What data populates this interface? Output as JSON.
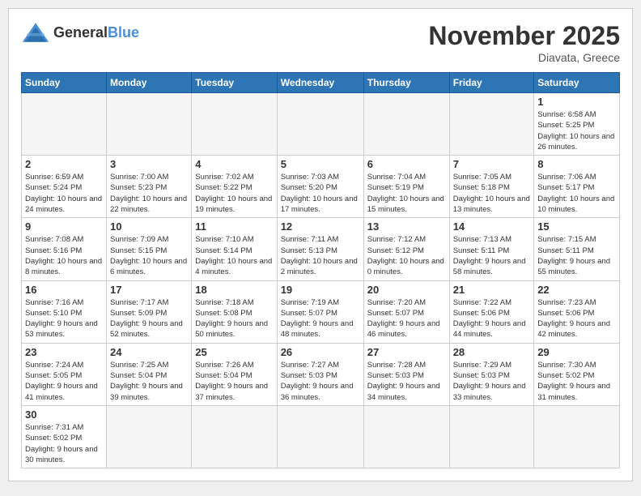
{
  "header": {
    "logo_general": "General",
    "logo_blue": "Blue",
    "month_title": "November 2025",
    "location": "Diavata, Greece"
  },
  "weekdays": [
    "Sunday",
    "Monday",
    "Tuesday",
    "Wednesday",
    "Thursday",
    "Friday",
    "Saturday"
  ],
  "weeks": [
    [
      {
        "day": "",
        "info": ""
      },
      {
        "day": "",
        "info": ""
      },
      {
        "day": "",
        "info": ""
      },
      {
        "day": "",
        "info": ""
      },
      {
        "day": "",
        "info": ""
      },
      {
        "day": "",
        "info": ""
      },
      {
        "day": "1",
        "info": "Sunrise: 6:58 AM\nSunset: 5:25 PM\nDaylight: 10 hours\nand 26 minutes."
      }
    ],
    [
      {
        "day": "2",
        "info": "Sunrise: 6:59 AM\nSunset: 5:24 PM\nDaylight: 10 hours\nand 24 minutes."
      },
      {
        "day": "3",
        "info": "Sunrise: 7:00 AM\nSunset: 5:23 PM\nDaylight: 10 hours\nand 22 minutes."
      },
      {
        "day": "4",
        "info": "Sunrise: 7:02 AM\nSunset: 5:22 PM\nDaylight: 10 hours\nand 19 minutes."
      },
      {
        "day": "5",
        "info": "Sunrise: 7:03 AM\nSunset: 5:20 PM\nDaylight: 10 hours\nand 17 minutes."
      },
      {
        "day": "6",
        "info": "Sunrise: 7:04 AM\nSunset: 5:19 PM\nDaylight: 10 hours\nand 15 minutes."
      },
      {
        "day": "7",
        "info": "Sunrise: 7:05 AM\nSunset: 5:18 PM\nDaylight: 10 hours\nand 13 minutes."
      },
      {
        "day": "8",
        "info": "Sunrise: 7:06 AM\nSunset: 5:17 PM\nDaylight: 10 hours\nand 10 minutes."
      }
    ],
    [
      {
        "day": "9",
        "info": "Sunrise: 7:08 AM\nSunset: 5:16 PM\nDaylight: 10 hours\nand 8 minutes."
      },
      {
        "day": "10",
        "info": "Sunrise: 7:09 AM\nSunset: 5:15 PM\nDaylight: 10 hours\nand 6 minutes."
      },
      {
        "day": "11",
        "info": "Sunrise: 7:10 AM\nSunset: 5:14 PM\nDaylight: 10 hours\nand 4 minutes."
      },
      {
        "day": "12",
        "info": "Sunrise: 7:11 AM\nSunset: 5:13 PM\nDaylight: 10 hours\nand 2 minutes."
      },
      {
        "day": "13",
        "info": "Sunrise: 7:12 AM\nSunset: 5:12 PM\nDaylight: 10 hours\nand 0 minutes."
      },
      {
        "day": "14",
        "info": "Sunrise: 7:13 AM\nSunset: 5:11 PM\nDaylight: 9 hours\nand 58 minutes."
      },
      {
        "day": "15",
        "info": "Sunrise: 7:15 AM\nSunset: 5:11 PM\nDaylight: 9 hours\nand 55 minutes."
      }
    ],
    [
      {
        "day": "16",
        "info": "Sunrise: 7:16 AM\nSunset: 5:10 PM\nDaylight: 9 hours\nand 53 minutes."
      },
      {
        "day": "17",
        "info": "Sunrise: 7:17 AM\nSunset: 5:09 PM\nDaylight: 9 hours\nand 52 minutes."
      },
      {
        "day": "18",
        "info": "Sunrise: 7:18 AM\nSunset: 5:08 PM\nDaylight: 9 hours\nand 50 minutes."
      },
      {
        "day": "19",
        "info": "Sunrise: 7:19 AM\nSunset: 5:07 PM\nDaylight: 9 hours\nand 48 minutes."
      },
      {
        "day": "20",
        "info": "Sunrise: 7:20 AM\nSunset: 5:07 PM\nDaylight: 9 hours\nand 46 minutes."
      },
      {
        "day": "21",
        "info": "Sunrise: 7:22 AM\nSunset: 5:06 PM\nDaylight: 9 hours\nand 44 minutes."
      },
      {
        "day": "22",
        "info": "Sunrise: 7:23 AM\nSunset: 5:06 PM\nDaylight: 9 hours\nand 42 minutes."
      }
    ],
    [
      {
        "day": "23",
        "info": "Sunrise: 7:24 AM\nSunset: 5:05 PM\nDaylight: 9 hours\nand 41 minutes."
      },
      {
        "day": "24",
        "info": "Sunrise: 7:25 AM\nSunset: 5:04 PM\nDaylight: 9 hours\nand 39 minutes."
      },
      {
        "day": "25",
        "info": "Sunrise: 7:26 AM\nSunset: 5:04 PM\nDaylight: 9 hours\nand 37 minutes."
      },
      {
        "day": "26",
        "info": "Sunrise: 7:27 AM\nSunset: 5:03 PM\nDaylight: 9 hours\nand 36 minutes."
      },
      {
        "day": "27",
        "info": "Sunrise: 7:28 AM\nSunset: 5:03 PM\nDaylight: 9 hours\nand 34 minutes."
      },
      {
        "day": "28",
        "info": "Sunrise: 7:29 AM\nSunset: 5:03 PM\nDaylight: 9 hours\nand 33 minutes."
      },
      {
        "day": "29",
        "info": "Sunrise: 7:30 AM\nSunset: 5:02 PM\nDaylight: 9 hours\nand 31 minutes."
      }
    ],
    [
      {
        "day": "30",
        "info": "Sunrise: 7:31 AM\nSunset: 5:02 PM\nDaylight: 9 hours\nand 30 minutes."
      },
      {
        "day": "",
        "info": ""
      },
      {
        "day": "",
        "info": ""
      },
      {
        "day": "",
        "info": ""
      },
      {
        "day": "",
        "info": ""
      },
      {
        "day": "",
        "info": ""
      },
      {
        "day": "",
        "info": ""
      }
    ]
  ]
}
